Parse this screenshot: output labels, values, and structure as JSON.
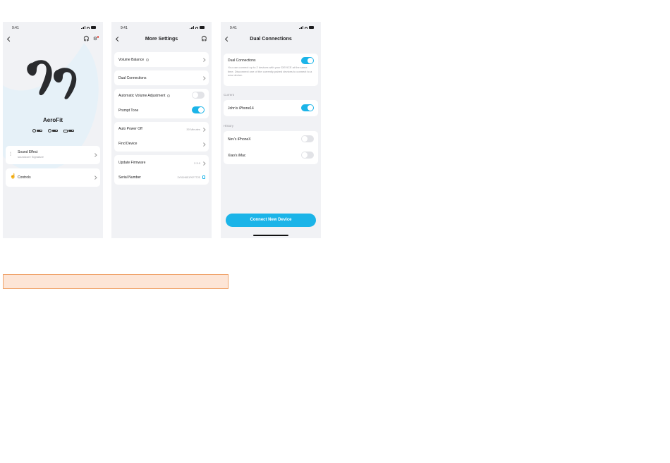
{
  "colors": {
    "accent": "#1bb4e8",
    "screen_bg": "#f1f2f5",
    "highlight_fill": "#fde5d6",
    "highlight_border": "#f0a46c"
  },
  "screen1": {
    "time": "9:41",
    "product_name": "AeroFit",
    "batteries": [
      {
        "side_icon": "left-earbud-icon"
      },
      {
        "side_icon": "right-earbud-icon"
      },
      {
        "side_icon": "case-icon"
      }
    ],
    "sound_effect": {
      "label": "Sound Effect",
      "subtitle": "soundcore Signature"
    },
    "controls": {
      "label": "Controls"
    }
  },
  "screen2": {
    "time": "9:41",
    "title": "More Settings",
    "rows": {
      "volume_balance": "Volume Balance",
      "dual_connections": "Dual Connections",
      "auto_volume": "Automatic Volume Adjustment",
      "prompt_tone": "Prompt Tone",
      "auto_power_off": "Auto Power Off",
      "auto_power_off_value": "30 Minutes",
      "find_device": "Find Device",
      "update_firmware": "Update Firmware",
      "firmware_value": "2.3.0",
      "serial_number": "Serial Number",
      "serial_value": "3Y5GH8S1P0F7T2E"
    },
    "toggles": {
      "auto_volume": false,
      "prompt_tone": true
    }
  },
  "screen3": {
    "time": "9:41",
    "title": "Dual Connections",
    "dual_label": "Dual Connections",
    "dual_desc": "You can connect up to 2 devices with your DEVICE at the same time. Disconnect one of the currently paired devices to connect to a new device.",
    "current_header": "Current",
    "current_device": "John's iPhone14",
    "history_header": "History",
    "history_devices": [
      "Nev's iPhoneX",
      "Xiao's iMac"
    ],
    "toggles": {
      "dual": true,
      "current": true,
      "history_0": false,
      "history_1": false
    },
    "cta": "Connect New Device"
  }
}
